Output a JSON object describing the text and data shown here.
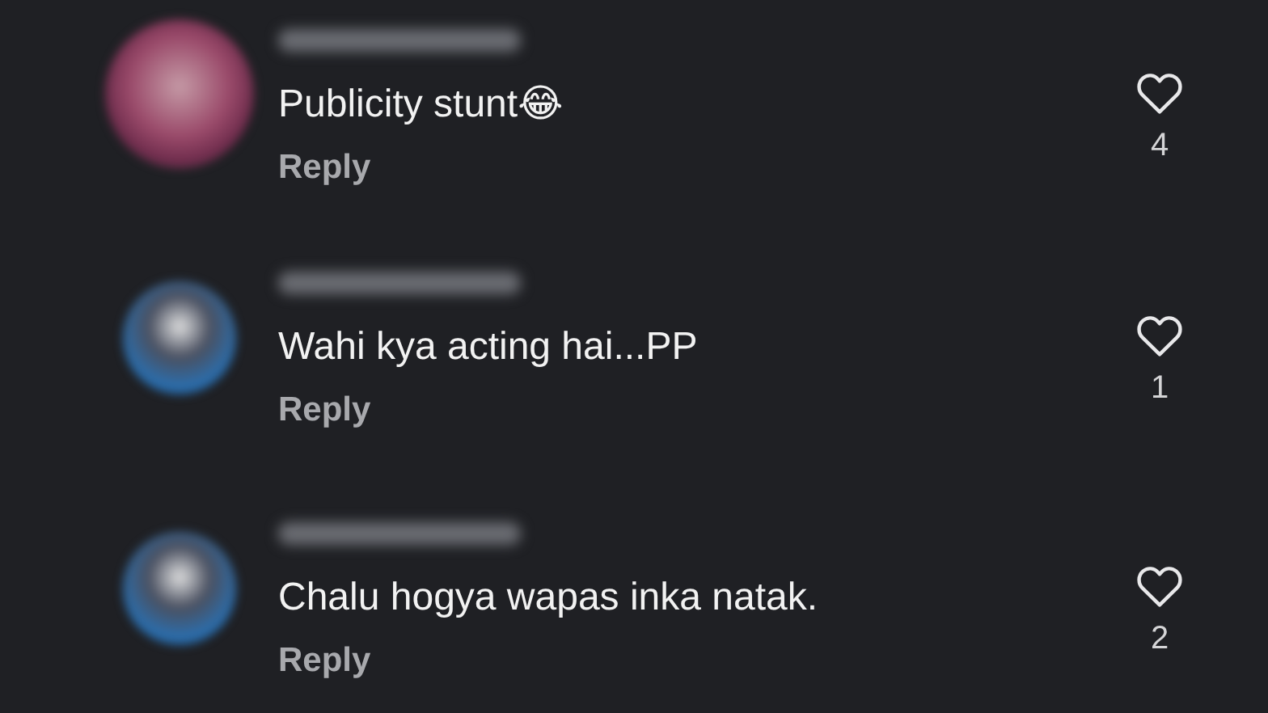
{
  "comments": [
    {
      "text": "Publicity stunt😂",
      "reply": "Reply",
      "likes": "4",
      "liked": false
    },
    {
      "text": "Wahi kya acting hai...PP",
      "reply": "Reply",
      "likes": "1",
      "liked": false
    },
    {
      "text": "Chalu hogya wapas inka natak.",
      "reply": "Reply",
      "likes": "2",
      "liked": false
    }
  ]
}
